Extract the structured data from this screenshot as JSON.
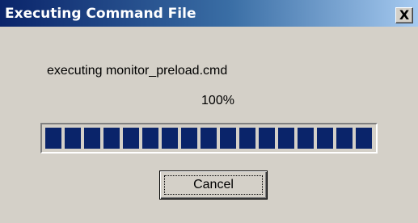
{
  "window": {
    "title": "Executing Command File",
    "close_glyph": "X"
  },
  "main": {
    "message": "executing monitor_preload.cmd",
    "progress_label": "100%",
    "progress_fraction": 1.0
  },
  "buttons": {
    "cancel_label": "Cancel"
  },
  "colors": {
    "progress_fill": "#0a246a",
    "dialog_background": "#d4d0c8"
  }
}
